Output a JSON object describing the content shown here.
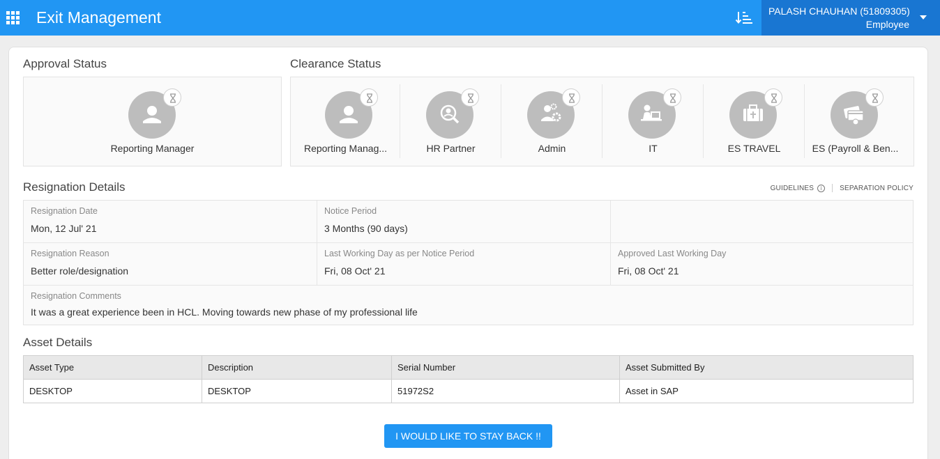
{
  "header": {
    "title": "Exit Management",
    "user_name": "PALASH CHAUHAN (51809305)",
    "user_role": "Employee",
    "icons": [
      "apps-grid-icon",
      "sort-icon",
      "caret-down-icon"
    ]
  },
  "approval": {
    "title": "Approval Status",
    "items": [
      {
        "label": "Reporting Manager",
        "icon": "person-icon"
      }
    ]
  },
  "clearance": {
    "title": "Clearance Status",
    "items": [
      {
        "label": "Reporting Manag...",
        "icon": "person-icon"
      },
      {
        "label": "HR Partner",
        "icon": "person-search-icon"
      },
      {
        "label": "Admin",
        "icon": "admin-gear-icon"
      },
      {
        "label": "IT",
        "icon": "laptop-user-icon"
      },
      {
        "label": "ES TRAVEL",
        "icon": "suitcase-icon"
      },
      {
        "label": "ES (Payroll & Ben...",
        "icon": "payroll-card-icon"
      }
    ]
  },
  "resignation": {
    "title": "Resignation Details",
    "guidelines_label": "GUIDELINES",
    "policy_label": "SEPARATION POLICY",
    "date_label": "Resignation Date",
    "date_value": "Mon, 12 Jul' 21",
    "notice_label": "Notice Period",
    "notice_value": "3 Months (90 days)",
    "reason_label": "Resignation Reason",
    "reason_value": "Better role/designation",
    "lwd_label": "Last Working Day as per Notice Period",
    "lwd_value": "Fri, 08 Oct' 21",
    "approved_lwd_label": "Approved Last Working Day",
    "approved_lwd_value": "Fri, 08 Oct' 21",
    "comments_label": "Resignation Comments",
    "comments_value": "It was a great experience been in HCL. Moving towards new phase of my professional life"
  },
  "assets": {
    "title": "Asset Details",
    "columns": [
      "Asset Type",
      "Description",
      "Serial Number",
      "Asset Submitted By"
    ],
    "rows": [
      [
        "DESKTOP",
        "DESKTOP",
        "51972S2",
        "Asset in SAP"
      ]
    ]
  },
  "actions": {
    "stay_back_label": "I WOULD LIKE TO STAY BACK !!"
  },
  "colors": {
    "header_bg": "#2196f3",
    "user_box_bg": "#1976d2",
    "avatar_bg": "#bdbdbd",
    "button_bg": "#2196f3"
  }
}
